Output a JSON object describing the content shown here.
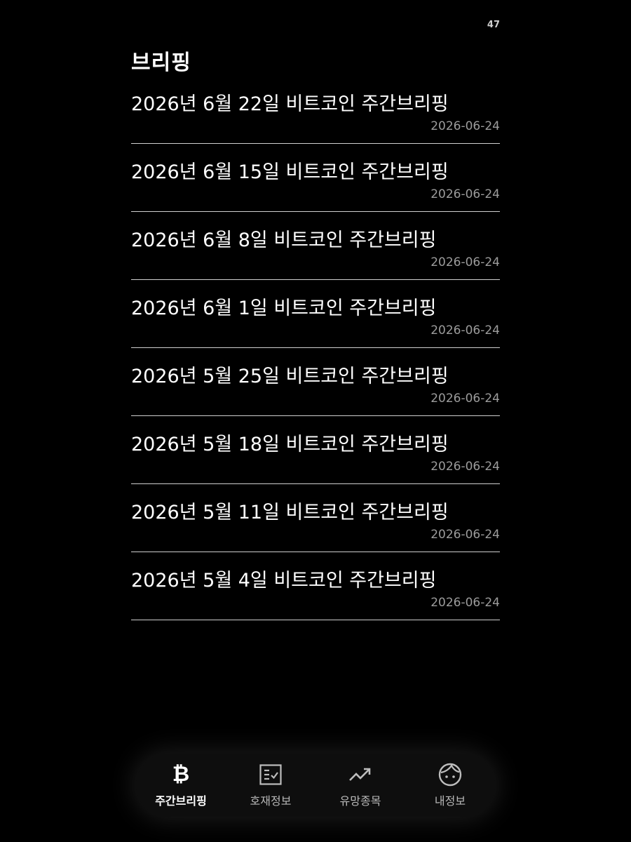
{
  "status": {
    "counter": "47"
  },
  "page": {
    "title": "브리핑"
  },
  "briefings": [
    {
      "title": "2026년 6월 22일 비트코인 주간브리핑",
      "date": "2026-06-24"
    },
    {
      "title": "2026년 6월 15일 비트코인 주간브리핑",
      "date": "2026-06-24"
    },
    {
      "title": "2026년 6월 8일 비트코인 주간브리핑",
      "date": "2026-06-24"
    },
    {
      "title": "2026년 6월 1일 비트코인 주간브리핑",
      "date": "2026-06-24"
    },
    {
      "title": "2026년 5월 25일 비트코인 주간브리핑",
      "date": "2026-06-24"
    },
    {
      "title": "2026년 5월 18일 비트코인 주간브리핑",
      "date": "2026-06-24"
    },
    {
      "title": "2026년 5월 11일 비트코인 주간브리핑",
      "date": "2026-06-24"
    },
    {
      "title": "2026년 5월 4일 비트코인 주간브리핑",
      "date": "2026-06-24"
    }
  ],
  "tabbar": {
    "tabs": [
      {
        "label": "주간브리핑",
        "icon": "bitcoin-icon",
        "active": true
      },
      {
        "label": "호재정보",
        "icon": "checklist-icon",
        "active": false
      },
      {
        "label": "유망종목",
        "icon": "trending-up-icon",
        "active": false
      },
      {
        "label": "내정보",
        "icon": "face-icon",
        "active": false
      }
    ]
  },
  "colors": {
    "background": "#000000",
    "text": "#ffffff",
    "date": "#9c9c9c",
    "divider": "#cfcfcf",
    "tabbar": "#0e0e0e"
  }
}
